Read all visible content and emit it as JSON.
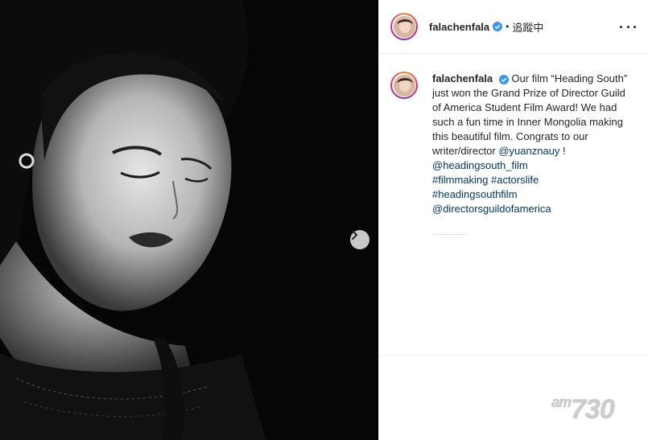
{
  "post": {
    "username": "falachenfala",
    "separator": "•",
    "follow_status": "追蹤中",
    "caption_username": "falachenfala",
    "caption_text_1": "Our film “Heading South” just won the Grand Prize of Director Guild of America Student Film Award! We had such a fun time in Inner Mongolia making this beautiful film. Congrats to our writer/director ",
    "mention_1": "@yuanznauy",
    "caption_text_2": " ! ",
    "mention_2": "@headingsouth_film",
    "hashtag_1": "#filmmaking",
    "hashtag_2": "#actorslife",
    "hashtag_3": "#headingsouthfilm",
    "mention_3": "@directorsguildofamerica"
  },
  "watermark": {
    "prefix": "am",
    "number": "730"
  },
  "icons": [
    "verified-badge-icon",
    "chevron-right-icon",
    "more-options-icon"
  ],
  "colors": {
    "link": "#00376b",
    "verified": "#3897f0",
    "text": "#262626"
  }
}
